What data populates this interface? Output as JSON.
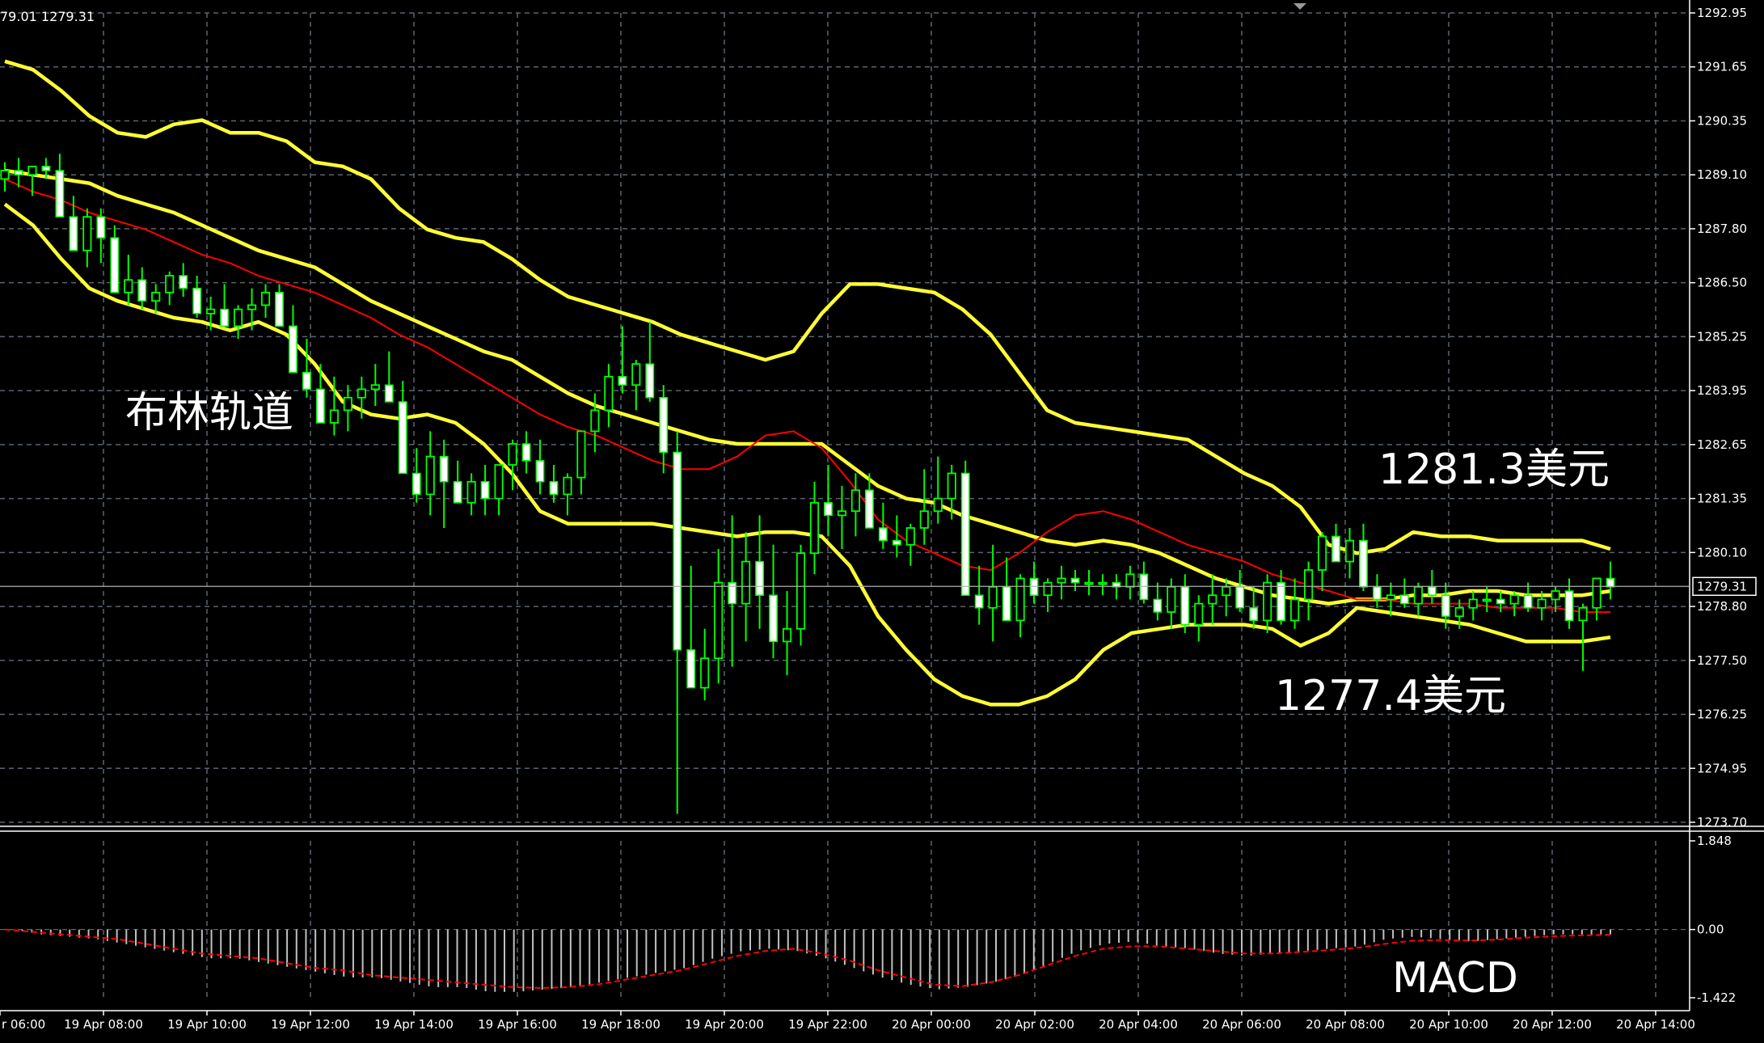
{
  "chart_data": {
    "type": "candlestick",
    "header_text": "79.01 1279.31",
    "price_axis": {
      "ticks": [
        "1292.95",
        "1291.65",
        "1290.35",
        "1289.10",
        "1287.80",
        "1286.50",
        "1285.25",
        "1283.95",
        "1282.65",
        "1281.35",
        "1280.10",
        "1278.80",
        "1277.50",
        "1276.25",
        "1274.95",
        "1273.70"
      ],
      "ylim": [
        1273.7,
        1292.95
      ]
    },
    "current_price": "1279.31",
    "time_axis": {
      "ticks": [
        "r 06:00",
        "19 Apr 08:00",
        "19 Apr 10:00",
        "19 Apr 12:00",
        "19 Apr 14:00",
        "19 Apr 16:00",
        "19 Apr 18:00",
        "19 Apr 20:00",
        "19 Apr 22:00",
        "20 Apr 00:00",
        "20 Apr 02:00",
        "20 Apr 04:00",
        "20 Apr 06:00",
        "20 Apr 08:00",
        "20 Apr 10:00",
        "20 Apr 12:00",
        "20 Apr 14:00"
      ]
    },
    "annotations": {
      "bollinger": "布林轨道",
      "upper": "1281.3美元",
      "lower": "1277.4美元",
      "macd": "MACD"
    },
    "macd_axis": {
      "ticks": [
        "1.848",
        "0.00",
        "-1.422"
      ],
      "ylim": [
        -1.422,
        1.848
      ]
    },
    "series": {
      "bb_upper": [
        1291.8,
        1291.6,
        1291.1,
        1290.5,
        1290.1,
        1290.0,
        1290.3,
        1290.4,
        1290.1,
        1290.1,
        1289.9,
        1289.4,
        1289.3,
        1289.0,
        1288.3,
        1287.8,
        1287.6,
        1287.5,
        1287.1,
        1286.6,
        1286.2,
        1286.0,
        1285.8,
        1285.6,
        1285.3,
        1285.1,
        1284.9,
        1284.7,
        1284.9,
        1285.8,
        1286.5,
        1286.5,
        1286.4,
        1286.3,
        1285.9,
        1285.3,
        1284.4,
        1283.5,
        1283.2,
        1283.1,
        1283.0,
        1282.9,
        1282.8,
        1282.4,
        1282.0,
        1281.7,
        1281.2,
        1280.3,
        1280.1,
        1280.2,
        1280.6,
        1280.5,
        1280.5,
        1280.4,
        1280.4,
        1280.4,
        1280.4,
        1280.2
      ],
      "bb_mid": [
        1289.2,
        1289.1,
        1289.0,
        1288.9,
        1288.6,
        1288.4,
        1288.2,
        1287.9,
        1287.6,
        1287.3,
        1287.1,
        1286.9,
        1286.5,
        1286.1,
        1285.8,
        1285.5,
        1285.2,
        1284.9,
        1284.7,
        1284.3,
        1283.9,
        1283.6,
        1283.4,
        1283.2,
        1283.0,
        1282.8,
        1282.7,
        1282.7,
        1282.7,
        1282.7,
        1282.2,
        1281.7,
        1281.4,
        1281.3,
        1281.0,
        1280.8,
        1280.6,
        1280.4,
        1280.3,
        1280.4,
        1280.3,
        1280.1,
        1279.8,
        1279.5,
        1279.3,
        1279.1,
        1279.0,
        1278.9,
        1279.0,
        1279.0,
        1279.1,
        1279.1,
        1279.2,
        1279.2,
        1279.1,
        1279.1,
        1279.1,
        1279.2
      ],
      "sma": [
        1289.0,
        1288.7,
        1288.5,
        1288.2,
        1288.0,
        1287.8,
        1287.5,
        1287.2,
        1287.0,
        1286.7,
        1286.5,
        1286.3,
        1286.0,
        1285.7,
        1285.3,
        1285.0,
        1284.6,
        1284.2,
        1283.8,
        1283.4,
        1283.1,
        1282.9,
        1282.6,
        1282.3,
        1282.1,
        1282.1,
        1282.4,
        1282.9,
        1283.0,
        1282.6,
        1281.8,
        1280.9,
        1280.4,
        1280.1,
        1279.8,
        1279.7,
        1280.1,
        1280.6,
        1281.0,
        1281.1,
        1280.9,
        1280.6,
        1280.3,
        1280.1,
        1279.9,
        1279.6,
        1279.4,
        1279.2,
        1279.0,
        1279.0,
        1278.9,
        1278.9,
        1278.9,
        1278.8,
        1278.8,
        1278.8,
        1278.7,
        1278.7
      ],
      "bb_lower": [
        1288.4,
        1287.9,
        1287.1,
        1286.4,
        1286.1,
        1285.9,
        1285.7,
        1285.6,
        1285.4,
        1285.6,
        1285.3,
        1284.6,
        1283.7,
        1283.4,
        1283.3,
        1283.4,
        1283.2,
        1282.7,
        1282.0,
        1281.1,
        1280.8,
        1280.8,
        1280.8,
        1280.8,
        1280.7,
        1280.6,
        1280.5,
        1280.6,
        1280.6,
        1280.5,
        1279.8,
        1278.6,
        1277.8,
        1277.1,
        1276.7,
        1276.5,
        1276.5,
        1276.7,
        1277.1,
        1277.8,
        1278.2,
        1278.3,
        1278.4,
        1278.4,
        1278.4,
        1278.3,
        1277.9,
        1278.2,
        1278.8,
        1278.7,
        1278.6,
        1278.5,
        1278.4,
        1278.2,
        1278.0,
        1278.0,
        1278.0,
        1278.1
      ],
      "macd": [
        0.0,
        -0.1,
        -0.15,
        -0.2,
        -0.3,
        -0.4,
        -0.5,
        -0.6,
        -0.6,
        -0.7,
        -0.8,
        -0.9,
        -1.0,
        -1.0,
        -1.1,
        -1.2,
        -1.2,
        -1.3,
        -1.3,
        -1.25,
        -1.2,
        -1.1,
        -1.0,
        -0.9,
        -0.8,
        -0.6,
        -0.45,
        -0.4,
        -0.45,
        -0.6,
        -0.8,
        -1.0,
        -1.15,
        -1.25,
        -1.2,
        -1.1,
        -0.95,
        -0.7,
        -0.45,
        -0.3,
        -0.25,
        -0.35,
        -0.4,
        -0.5,
        -0.55,
        -0.5,
        -0.45,
        -0.4,
        -0.35,
        -0.2,
        -0.15,
        -0.2,
        -0.25,
        -0.2,
        -0.15,
        -0.1,
        -0.1,
        -0.1
      ],
      "macd_signal": [
        0.0,
        -0.05,
        -0.1,
        -0.15,
        -0.2,
        -0.3,
        -0.4,
        -0.5,
        -0.55,
        -0.6,
        -0.7,
        -0.8,
        -0.85,
        -0.95,
        -1.0,
        -1.05,
        -1.1,
        -1.15,
        -1.2,
        -1.22,
        -1.2,
        -1.15,
        -1.05,
        -0.95,
        -0.85,
        -0.7,
        -0.55,
        -0.45,
        -0.4,
        -0.5,
        -0.65,
        -0.85,
        -1.0,
        -1.15,
        -1.18,
        -1.1,
        -0.95,
        -0.75,
        -0.55,
        -0.4,
        -0.35,
        -0.35,
        -0.4,
        -0.45,
        -0.5,
        -0.5,
        -0.47,
        -0.43,
        -0.38,
        -0.3,
        -0.23,
        -0.22,
        -0.23,
        -0.21,
        -0.17,
        -0.14,
        -0.12,
        -0.11
      ]
    },
    "candles": [
      [
        1289.0,
        1289.4,
        1288.7,
        1289.2
      ],
      [
        1289.2,
        1289.5,
        1288.8,
        1289.1
      ],
      [
        1289.1,
        1289.3,
        1288.6,
        1289.3
      ],
      [
        1289.3,
        1289.5,
        1289.0,
        1289.2
      ],
      [
        1289.2,
        1289.6,
        1288.5,
        1288.1
      ],
      [
        1288.1,
        1288.6,
        1287.5,
        1287.3
      ],
      [
        1287.3,
        1288.3,
        1286.9,
        1288.1
      ],
      [
        1288.1,
        1288.3,
        1287.0,
        1287.6
      ],
      [
        1287.6,
        1287.9,
        1286.3,
        1286.3
      ],
      [
        1286.3,
        1287.2,
        1286.0,
        1286.6
      ],
      [
        1286.6,
        1286.9,
        1285.9,
        1286.1
      ],
      [
        1286.1,
        1286.5,
        1285.8,
        1286.3
      ],
      [
        1286.3,
        1286.8,
        1286.0,
        1286.7
      ],
      [
        1286.7,
        1287.0,
        1286.2,
        1286.4
      ],
      [
        1286.4,
        1286.7,
        1285.7,
        1285.8
      ],
      [
        1285.8,
        1286.2,
        1285.4,
        1285.9
      ],
      [
        1285.9,
        1286.5,
        1285.5,
        1285.5
      ],
      [
        1285.5,
        1286.0,
        1285.2,
        1285.9
      ],
      [
        1285.9,
        1286.4,
        1285.4,
        1286.0
      ],
      [
        1286.0,
        1286.5,
        1285.7,
        1286.3
      ],
      [
        1286.3,
        1286.5,
        1285.6,
        1285.5
      ],
      [
        1285.5,
        1286.0,
        1285.1,
        1284.4
      ],
      [
        1284.4,
        1285.2,
        1283.8,
        1284.0
      ],
      [
        1284.0,
        1284.6,
        1283.3,
        1283.2
      ],
      [
        1283.2,
        1284.3,
        1282.9,
        1283.5
      ],
      [
        1283.5,
        1284.1,
        1283.0,
        1283.8
      ],
      [
        1283.8,
        1284.3,
        1283.3,
        1284.0
      ],
      [
        1284.0,
        1284.6,
        1283.6,
        1284.1
      ],
      [
        1284.1,
        1284.9,
        1283.8,
        1283.7
      ],
      [
        1283.7,
        1284.2,
        1282.0,
        1282.0
      ],
      [
        1282.0,
        1282.6,
        1281.3,
        1281.5
      ],
      [
        1281.5,
        1283.0,
        1281.0,
        1282.4
      ],
      [
        1282.4,
        1282.8,
        1280.7,
        1281.8
      ],
      [
        1281.8,
        1282.3,
        1281.3,
        1281.3
      ],
      [
        1281.3,
        1282.0,
        1281.0,
        1281.8
      ],
      [
        1281.8,
        1282.2,
        1281.0,
        1281.4
      ],
      [
        1281.4,
        1282.0,
        1281.0,
        1282.2
      ],
      [
        1282.2,
        1282.8,
        1281.6,
        1282.7
      ],
      [
        1282.7,
        1283.0,
        1282.0,
        1282.3
      ],
      [
        1282.3,
        1282.8,
        1281.5,
        1281.8
      ],
      [
        1281.8,
        1282.2,
        1281.3,
        1281.5
      ],
      [
        1281.5,
        1282.0,
        1281.0,
        1281.9
      ],
      [
        1281.9,
        1282.6,
        1281.5,
        1283.0
      ],
      [
        1283.0,
        1283.9,
        1282.5,
        1283.5
      ],
      [
        1283.5,
        1284.6,
        1283.1,
        1284.3
      ],
      [
        1284.3,
        1285.5,
        1283.9,
        1284.1
      ],
      [
        1284.1,
        1284.7,
        1283.5,
        1284.6
      ],
      [
        1284.6,
        1285.6,
        1283.7,
        1283.8
      ],
      [
        1283.8,
        1284.1,
        1282.0,
        1282.5
      ],
      [
        1282.5,
        1283.0,
        1273.9,
        1277.8
      ],
      [
        1277.8,
        1279.8,
        1277.0,
        1276.9
      ],
      [
        1276.9,
        1278.3,
        1276.6,
        1277.6
      ],
      [
        1277.6,
        1280.2,
        1277.0,
        1279.4
      ],
      [
        1279.4,
        1281.0,
        1277.4,
        1278.9
      ],
      [
        1278.9,
        1280.6,
        1278.0,
        1279.9
      ],
      [
        1279.9,
        1281.0,
        1278.3,
        1279.1
      ],
      [
        1279.1,
        1280.3,
        1277.6,
        1278.0
      ],
      [
        1278.0,
        1279.2,
        1277.2,
        1278.3
      ],
      [
        1278.3,
        1280.3,
        1277.9,
        1280.1
      ],
      [
        1280.1,
        1281.8,
        1279.6,
        1281.3
      ],
      [
        1281.3,
        1282.2,
        1280.5,
        1281.0
      ],
      [
        1281.0,
        1281.7,
        1280.2,
        1281.1
      ],
      [
        1281.1,
        1282.0,
        1280.5,
        1281.6
      ],
      [
        1281.6,
        1282.0,
        1280.9,
        1280.7
      ],
      [
        1280.7,
        1281.3,
        1280.2,
        1280.4
      ],
      [
        1280.4,
        1281.0,
        1280.0,
        1280.3
      ],
      [
        1280.3,
        1280.8,
        1279.8,
        1280.7
      ],
      [
        1280.7,
        1282.1,
        1280.3,
        1281.1
      ],
      [
        1281.1,
        1282.4,
        1280.8,
        1281.4
      ],
      [
        1281.4,
        1282.2,
        1280.9,
        1282.0
      ],
      [
        1282.0,
        1282.3,
        1279.2,
        1279.1
      ],
      [
        1279.1,
        1279.8,
        1278.4,
        1278.8
      ],
      [
        1278.8,
        1280.3,
        1278.0,
        1279.3
      ],
      [
        1279.3,
        1280.0,
        1278.6,
        1278.5
      ],
      [
        1278.5,
        1279.6,
        1278.1,
        1279.5
      ],
      [
        1279.5,
        1279.9,
        1278.9,
        1279.1
      ],
      [
        1279.1,
        1279.5,
        1278.7,
        1279.4
      ],
      [
        1279.4,
        1279.8,
        1279.0,
        1279.5
      ],
      [
        1279.5,
        1279.7,
        1279.2,
        1279.4
      ],
      [
        1279.4,
        1279.7,
        1279.1,
        1279.4
      ],
      [
        1279.4,
        1279.6,
        1279.1,
        1279.4
      ],
      [
        1279.4,
        1279.6,
        1279.0,
        1279.3
      ],
      [
        1279.3,
        1279.8,
        1279.0,
        1279.6
      ],
      [
        1279.6,
        1279.9,
        1278.9,
        1279.0
      ],
      [
        1279.0,
        1279.4,
        1278.5,
        1278.7
      ],
      [
        1278.7,
        1279.5,
        1278.3,
        1279.3
      ],
      [
        1279.3,
        1279.6,
        1278.2,
        1278.4
      ],
      [
        1278.4,
        1279.1,
        1278.0,
        1278.9
      ],
      [
        1278.9,
        1279.6,
        1278.4,
        1279.1
      ],
      [
        1279.1,
        1279.5,
        1278.6,
        1279.3
      ],
      [
        1279.3,
        1279.7,
        1278.7,
        1278.8
      ],
      [
        1278.8,
        1279.3,
        1278.3,
        1278.5
      ],
      [
        1278.5,
        1279.6,
        1278.2,
        1279.4
      ],
      [
        1279.4,
        1279.7,
        1278.4,
        1278.5
      ],
      [
        1278.5,
        1279.5,
        1278.3,
        1279.0
      ],
      [
        1279.0,
        1279.9,
        1278.5,
        1279.7
      ],
      [
        1279.7,
        1280.6,
        1279.2,
        1280.5
      ],
      [
        1280.5,
        1280.8,
        1280.0,
        1279.9
      ],
      [
        1279.9,
        1280.7,
        1279.5,
        1280.4
      ],
      [
        1280.4,
        1280.8,
        1279.2,
        1279.3
      ],
      [
        1279.3,
        1279.6,
        1278.8,
        1279.0
      ],
      [
        1279.0,
        1279.4,
        1278.6,
        1279.1
      ],
      [
        1279.1,
        1279.5,
        1278.8,
        1278.9
      ],
      [
        1278.9,
        1279.4,
        1278.6,
        1279.3
      ],
      [
        1279.3,
        1279.7,
        1278.9,
        1279.1
      ],
      [
        1279.1,
        1279.4,
        1278.3,
        1278.6
      ],
      [
        1278.6,
        1279.0,
        1278.3,
        1278.8
      ],
      [
        1278.8,
        1279.2,
        1278.5,
        1279.0
      ],
      [
        1279.0,
        1279.3,
        1278.7,
        1279.0
      ],
      [
        1279.0,
        1279.2,
        1278.7,
        1278.9
      ],
      [
        1278.9,
        1279.2,
        1278.6,
        1279.1
      ],
      [
        1279.1,
        1279.4,
        1278.7,
        1278.8
      ],
      [
        1278.8,
        1279.2,
        1278.5,
        1279.0
      ],
      [
        1279.0,
        1279.3,
        1278.7,
        1279.2
      ],
      [
        1279.2,
        1279.5,
        1278.3,
        1278.5
      ],
      [
        1278.5,
        1278.9,
        1277.3,
        1278.8
      ],
      [
        1278.8,
        1279.5,
        1278.5,
        1279.5
      ],
      [
        1279.5,
        1279.9,
        1279.0,
        1279.3
      ]
    ],
    "colors": {
      "background": "#000000",
      "grid": "#5a6470",
      "axis": "#ffffff",
      "candle": "#00ff00",
      "bollinger": "#ffff33",
      "sma": "#ff0000",
      "macd_hist": "#c0c0c0",
      "macd_signal": "#ff0000"
    }
  }
}
